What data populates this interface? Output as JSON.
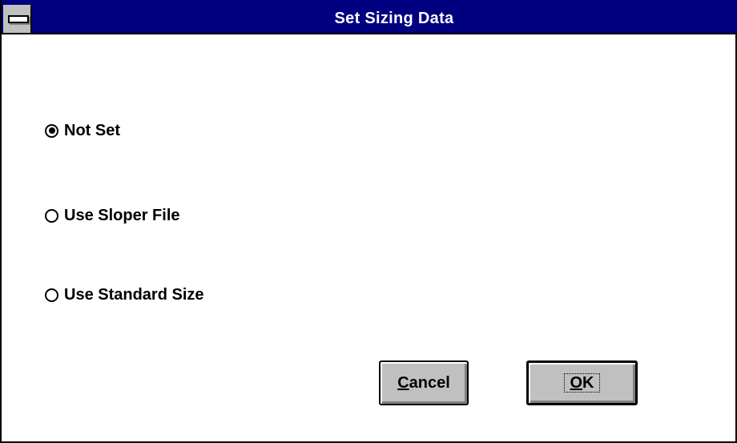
{
  "window": {
    "title": "Set Sizing Data"
  },
  "options": [
    {
      "label": "Not Set",
      "selected": true
    },
    {
      "label": "Use Sloper File",
      "selected": false
    },
    {
      "label": "Use Standard Size",
      "selected": false
    }
  ],
  "buttons": {
    "cancel": {
      "mnemonic": "C",
      "rest": "ancel"
    },
    "ok": {
      "mnemonic": "O",
      "rest": "K"
    }
  },
  "colors": {
    "titlebar": "#000080",
    "button_face": "#c0c0c0",
    "background": "#ffffff"
  },
  "icons": {
    "system_menu": "system-menu-icon",
    "radio_selected": "radio-selected-icon",
    "radio_unselected": "radio-unselected-icon"
  }
}
